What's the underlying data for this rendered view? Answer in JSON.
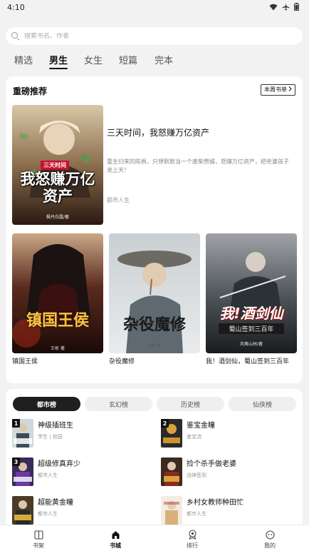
{
  "status_bar": {
    "time": "4:10",
    "wifi_icon": "wifi-icon",
    "airplane_icon": "airplane-icon",
    "battery_icon": "battery-icon"
  },
  "search": {
    "placeholder": "搜索书名、作者"
  },
  "tabs": [
    {
      "label": "精选",
      "active": false
    },
    {
      "label": "男生",
      "active": true
    },
    {
      "label": "女生",
      "active": false
    },
    {
      "label": "短篇",
      "active": false
    },
    {
      "label": "完本",
      "active": false
    }
  ],
  "featured_section": {
    "title": "重磅推荐",
    "weekly_button": "本周书单",
    "featured_book": {
      "title": "三天时间，我怒赚万亿资产",
      "description": "重生归来的陈枫，只想默默当一个废柴赘婿，怒赚万亿资产，把老婆孩子宠上天！",
      "category": "都市人生",
      "cover_text": "我怒赚万亿资产",
      "cover_badge": "三天时间",
      "cover_author": "枫丹白露/著"
    },
    "books": [
      {
        "title": "镇国王侯",
        "cover_text": "镇国王侯",
        "cover_author": "王彬 著"
      },
      {
        "title": "杂役魔修",
        "cover_text": "杂役魔修",
        "cover_author": "晴空 著"
      },
      {
        "title": "我！酒剑仙，蜀山签到三百年",
        "cover_text": "我!酒剑仙",
        "cover_subtext": "蜀山签到三百年",
        "cover_author": "风舞山林/著"
      }
    ]
  },
  "rank_section": {
    "tabs": [
      {
        "label": "都市榜",
        "active": true
      },
      {
        "label": "玄幻榜",
        "active": false
      },
      {
        "label": "历史榜",
        "active": false
      },
      {
        "label": "仙侠榜",
        "active": false
      }
    ],
    "items": [
      {
        "rank": "1",
        "title": "神级插班生",
        "sub": "学生 | 校园",
        "cover_text": "神级插班生"
      },
      {
        "rank": "2",
        "title": "鉴宝金瞳",
        "sub": "鉴宝流",
        "cover_text": "鉴宝金瞳"
      },
      {
        "rank": "3",
        "title": "超级修真弃少",
        "sub": "都市人生",
        "cover_text": "超级修真弃少"
      },
      {
        "rank": "",
        "title": "捡个杀手做老婆",
        "sub": "战神签到",
        "cover_text": "捡个杀手做老婆"
      },
      {
        "rank": "",
        "title": "超能黄金瞳",
        "sub": "都市人生",
        "cover_text": "超能黄金瞳"
      },
      {
        "rank": "",
        "title": "乡村女教师种田忙",
        "sub": "都市人生",
        "cover_text": "乡村女教师种田忙"
      }
    ]
  },
  "bottom_nav": [
    {
      "label": "书架",
      "icon": "bookshelf-icon",
      "active": false
    },
    {
      "label": "书城",
      "icon": "bookstore-icon",
      "active": true
    },
    {
      "label": "排行",
      "icon": "ranking-icon",
      "active": false
    },
    {
      "label": "我的",
      "icon": "profile-icon",
      "active": false
    }
  ]
}
